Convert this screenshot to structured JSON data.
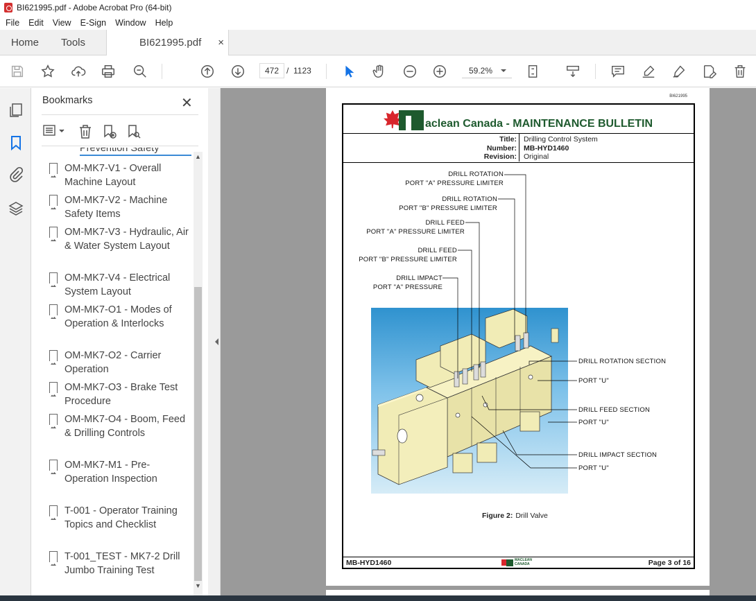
{
  "window": {
    "title": "BI621995.pdf - Adobe Acrobat Pro (64-bit)"
  },
  "menu": [
    "File",
    "Edit",
    "View",
    "E-Sign",
    "Window",
    "Help"
  ],
  "tabs": {
    "home": "Home",
    "tools": "Tools",
    "document": "BI621995.pdf",
    "close": "×"
  },
  "toolbar": {
    "current_page": "472",
    "page_separator": "/",
    "total_pages": "1123",
    "zoom": "59.2%"
  },
  "bookmarks": {
    "title": "Bookmarks",
    "close": "✕",
    "partial_item": "Prevention Safety",
    "items": [
      "OM-MK7-V1 - Overall Machine Layout",
      "OM-MK7-V2 - Machine Safety Items",
      "OM-MK7-V3 - Hydraulic, Air & Water System Layout",
      "OM-MK7-V4 - Electrical System Layout",
      "OM-MK7-O1 - Modes of Operation & Interlocks",
      "OM-MK7-O2 - Carrier Operation",
      "OM-MK7-O3 - Brake Test Procedure",
      "OM-MK7-O4 - Boom, Feed & Drilling Controls",
      "OM-MK7-M1 - Pre-Operation Inspection",
      "T-001 - Operator Training Topics and Checklist",
      "T-001_TEST - MK7-2 Drill Jumbo Training Test"
    ]
  },
  "document": {
    "doc_id": "BI621995",
    "brand": "aclean Canada - MAINTENANCE BULLETIN",
    "meta_labels": {
      "title": "Title:",
      "number": "Number:",
      "revision": "Revision:"
    },
    "meta_values": {
      "title": "Drilling Control System",
      "number": "MB-HYD1460",
      "revision": "Original"
    },
    "callouts_left": [
      [
        "DRILL ROTATION",
        "PORT \"A\" PRESSURE LIMITER"
      ],
      [
        "DRILL ROTATION",
        "PORT \"B\" PRESSURE LIMITER"
      ],
      [
        "DRILL FEED",
        "PORT \"A\" PRESSURE LIMITER"
      ],
      [
        "DRILL FEED",
        "PORT \"B\" PRESSURE LIMITER"
      ],
      [
        "DRILL IMPACT",
        "PORT \"A\" PRESSURE"
      ]
    ],
    "callouts_right": [
      "DRILL ROTATION SECTION",
      "PORT \"U\"",
      "DRILL FEED SECTION",
      "PORT \"U\"",
      "DRILL IMPACT SECTION",
      "PORT \"U\""
    ],
    "caption_label": "Figure 2:",
    "caption_text": "Drill Valve",
    "footer_left": "MB-HYD1460",
    "footer_logo": "MACLEAN CANADA",
    "footer_right": "Page 3 of 16"
  }
}
